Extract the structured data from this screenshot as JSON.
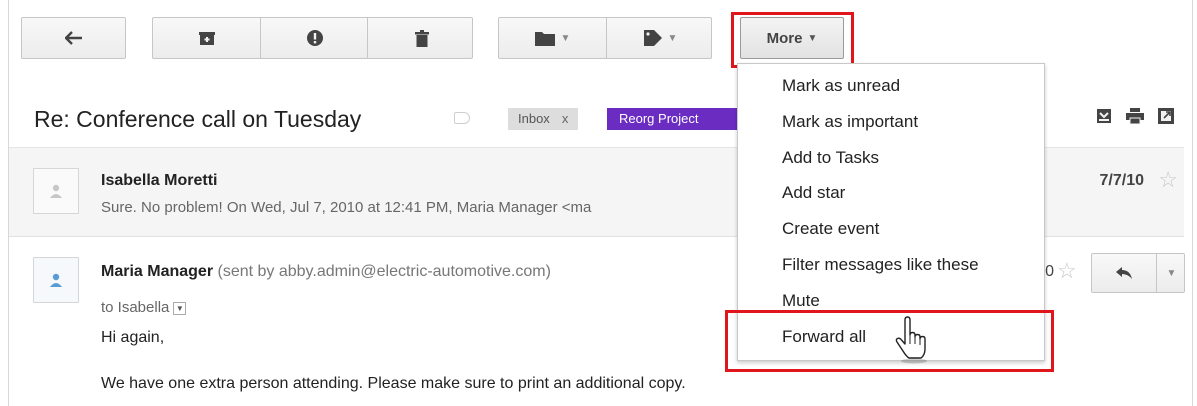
{
  "toolbar": {
    "buttons": [
      {
        "name": "back",
        "icon": "back-arrow-icon"
      },
      {
        "name": "archive",
        "icon": "archive-icon"
      },
      {
        "name": "spam",
        "icon": "report-spam-icon"
      },
      {
        "name": "delete",
        "icon": "trash-icon"
      },
      {
        "name": "move-to",
        "icon": "folder-icon"
      },
      {
        "name": "labels",
        "icon": "tag-icon"
      }
    ],
    "more_label": "More"
  },
  "conversation": {
    "subject": "Re: Conference call on Tuesday",
    "labels": [
      {
        "text": "Inbox",
        "remove": "x"
      },
      {
        "text": "Reorg Project",
        "color": "#6a2cc1"
      }
    ]
  },
  "messages": [
    {
      "sender": "Isabella Moretti",
      "snippet": "Sure. No problem! On Wed, Jul 7, 2010 at 12:41 PM, Maria Manager <ma",
      "date": "7/7/10"
    },
    {
      "sender": "Maria Manager",
      "sent_by": "(sent by abby.admin@electric-automotive.com)",
      "to": "to Isabella",
      "date_partial": "0",
      "body": [
        "Hi again,",
        "We have one extra person attending. Please make sure to print an additional copy."
      ]
    }
  ],
  "more_menu": {
    "items": [
      "Mark as unread",
      "Mark as important",
      "Add to Tasks",
      "Add star",
      "Create event",
      "Filter messages like these",
      "Mute",
      "Forward all"
    ]
  },
  "colors": {
    "highlight": "#e0161c",
    "label_purple": "#6a2cc1"
  }
}
